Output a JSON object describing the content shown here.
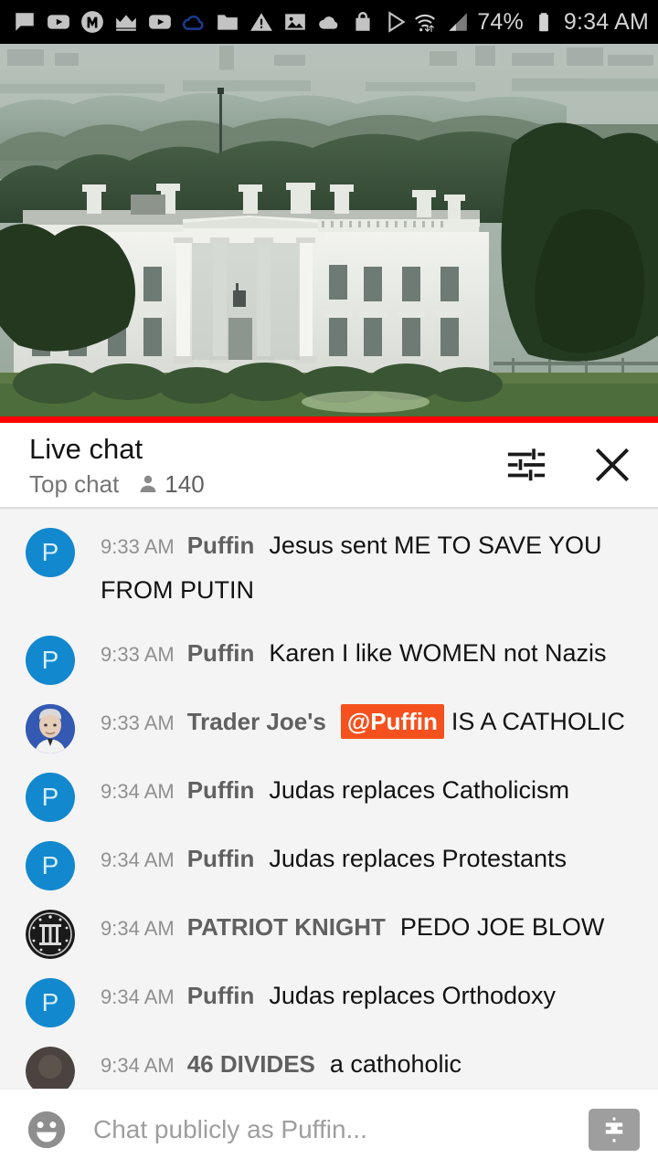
{
  "statusbar": {
    "icons": [
      "chat-bubble-icon",
      "youtube-play-icon",
      "monkey-m-icon",
      "crown-icon",
      "youtube-play-icon-2",
      "cloud-outline-icon",
      "folder-icon",
      "warning-triangle-icon",
      "photo-icon",
      "cloud-filled-icon",
      "shopping-bag-icon",
      "play-store-icon"
    ],
    "wifi_icon": "wifi-transfer-icon",
    "signal_icon": "cell-signal-icon",
    "battery_percent": "74%",
    "battery_icon": "battery-icon",
    "time": "9:34 AM"
  },
  "video": {
    "name": "white-house-live-stream",
    "progress_color": "#ff0000"
  },
  "chat_header": {
    "title": "Live chat",
    "mode": "Top chat",
    "viewer_count": "140",
    "person_icon": "person-icon",
    "tune_icon": "tune-icon",
    "close_icon": "close-icon"
  },
  "messages": [
    {
      "avatar_type": "letter",
      "avatar_letter": "P",
      "timestamp": "9:33 AM",
      "author": "Puffin",
      "text": "Jesus sent ME TO SAVE YOU FROM PUTIN",
      "mention": null
    },
    {
      "avatar_type": "letter",
      "avatar_letter": "P",
      "timestamp": "9:33 AM",
      "author": "Puffin",
      "text": "Karen I like WOMEN not Nazis",
      "mention": null
    },
    {
      "avatar_type": "photo-man-blue",
      "avatar_letter": "",
      "timestamp": "9:33 AM",
      "author": "Trader Joe's",
      "text": "IS A CATHOLIC",
      "mention": "@Puffin"
    },
    {
      "avatar_type": "letter",
      "avatar_letter": "P",
      "timestamp": "9:34 AM",
      "author": "Puffin",
      "text": "Judas replaces Catholicism",
      "mention": null
    },
    {
      "avatar_type": "letter",
      "avatar_letter": "P",
      "timestamp": "9:34 AM",
      "author": "Puffin",
      "text": "Judas replaces Protestants",
      "mention": null
    },
    {
      "avatar_type": "emblem-three-percent",
      "avatar_letter": "",
      "timestamp": "9:34 AM",
      "author": "PATRIOT KNIGHT",
      "text": "PEDO JOE BLOW",
      "mention": null
    },
    {
      "avatar_type": "letter",
      "avatar_letter": "P",
      "timestamp": "9:34 AM",
      "author": "Puffin",
      "text": "Judas replaces Orthodoxy",
      "mention": null
    },
    {
      "avatar_type": "photo-dark",
      "avatar_letter": "",
      "timestamp": "9:34 AM",
      "author": "46 DIVIDES",
      "text": "a cathoholic",
      "mention": null
    }
  ],
  "input_bar": {
    "emoji_icon": "emoji-face-icon",
    "placeholder": "Chat publicly as Puffin...",
    "superchat_icon": "dollar-superchat-icon"
  },
  "colors": {
    "accent_red": "#ff0000",
    "mention_orange": "#f4511e",
    "avatar_blue": "#1288ce",
    "chat_bg": "#f4f4f4"
  }
}
